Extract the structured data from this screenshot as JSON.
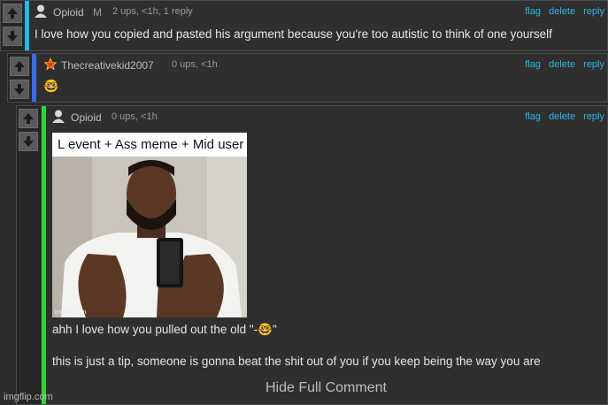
{
  "comments": [
    {
      "username": "Opioid",
      "flair": "M",
      "meta": "2 ups, <1h, 1 reply",
      "text": "I love how you copied and pasted his argument because you're too autistic to think of one yourself",
      "bar_color": "#27b5ea"
    },
    {
      "username": "Thecreativekid2007",
      "meta": "0 ups, <1h",
      "emoji": "🤓",
      "bar_color": "#3f6be0"
    },
    {
      "username": "Opioid",
      "meta": "0 ups, <1h",
      "meme_caption": "L event + Ass meme + Mid user",
      "meme_watermark": "imgflip.com",
      "line1_pre": "ahh I love how you pulled out the old \"-",
      "line1_emoji": "🤓",
      "line1_post": "\"",
      "line2": "this is just a tip, someone is gonna beat the shit out of you if you keep being the way you are",
      "hide_label": "Hide Full Comment",
      "bar_color": "#2fd63a"
    }
  ],
  "actions": {
    "flag": "flag",
    "delete": "delete",
    "reply": "reply"
  },
  "watermark": "imgflip.com"
}
